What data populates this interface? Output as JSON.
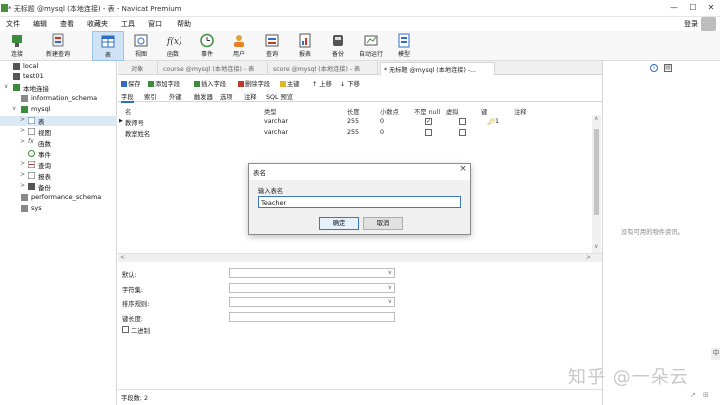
{
  "window": {
    "title": "* 无标题 @mysql (本地连接) - 表 - Navicat Premium",
    "controls": [
      "—",
      "☐",
      "✕"
    ]
  },
  "menu": [
    "文件",
    "编辑",
    "查看",
    "收藏夹",
    "工具",
    "窗口",
    "帮助"
  ],
  "login_label": "登录",
  "toolbar": [
    {
      "label": "连接",
      "icon": "plug-icon"
    },
    {
      "label": "新建查询",
      "icon": "new-query-icon"
    },
    {
      "label": "表",
      "icon": "table-icon",
      "active": true
    },
    {
      "label": "视图",
      "icon": "view-icon"
    },
    {
      "label": "函数",
      "icon": "function-icon"
    },
    {
      "label": "事件",
      "icon": "clock-icon"
    },
    {
      "label": "用户",
      "icon": "user-icon"
    },
    {
      "label": "查询",
      "icon": "query-icon"
    },
    {
      "label": "报表",
      "icon": "report-icon"
    },
    {
      "label": "备份",
      "icon": "backup-icon"
    },
    {
      "label": "自动运行",
      "icon": "autorun-icon"
    },
    {
      "label": "模型",
      "icon": "model-icon"
    }
  ],
  "nav": {
    "items": [
      {
        "label": "local",
        "level": 0,
        "twisty": ""
      },
      {
        "label": "test01",
        "level": 0,
        "twisty": ""
      },
      {
        "label": "本地连接",
        "level": 0,
        "twisty": "∨"
      },
      {
        "label": "information_schema",
        "level": 1,
        "twisty": ""
      },
      {
        "label": "mysql",
        "level": 1,
        "twisty": "∨"
      },
      {
        "label": "表",
        "level": 2,
        "twisty": ">",
        "selected": true
      },
      {
        "label": "视图",
        "level": 2,
        "twisty": ">"
      },
      {
        "label": "函数",
        "level": 2,
        "twisty": ">"
      },
      {
        "label": "事件",
        "level": 2,
        "twisty": ""
      },
      {
        "label": "查询",
        "level": 2,
        "twisty": ">"
      },
      {
        "label": "报表",
        "level": 2,
        "twisty": ">"
      },
      {
        "label": "备份",
        "level": 2,
        "twisty": ">"
      },
      {
        "label": "performance_schema",
        "level": 1,
        "twisty": ""
      },
      {
        "label": "sys",
        "level": 1,
        "twisty": ""
      }
    ]
  },
  "tabs": [
    "对象",
    "course @mysql (本地连接) - 表",
    "score @mysql (本地连接) - 表",
    "* 无标题 @mysql (本地连接) -..."
  ],
  "subtoolbar": [
    "保存",
    "添加字段",
    "插入字段",
    "删除字段",
    "主键",
    "↑ 上移",
    "↓ 下移"
  ],
  "subtabs": [
    "字段",
    "索引",
    "外键",
    "触发器",
    "选项",
    "注释",
    "SQL 预览"
  ],
  "grid": {
    "headers": [
      "名",
      "类型",
      "长度",
      "小数点",
      "不是 null",
      "虚拟",
      "键",
      "注释"
    ],
    "rows": [
      {
        "name": "教师号",
        "type": "varchar",
        "length": "255",
        "decimal": "0",
        "notnull": true,
        "virtual": false,
        "key": "1",
        "current": true
      },
      {
        "name": "教室姓名",
        "type": "varchar",
        "length": "255",
        "decimal": "0",
        "notnull": false,
        "virtual": false,
        "key": "",
        "current": false
      }
    ]
  },
  "props": {
    "default_label": "默认:",
    "charset_label": "字符集:",
    "collation_label": "排序规则:",
    "keylen_label": "键长度:",
    "binary_label": "二进制"
  },
  "status": {
    "field_count": "字段数: 2"
  },
  "rpanel": {
    "empty_text": "没有可用的物件资讯。"
  },
  "dialog": {
    "title": "表名",
    "prompt": "输入表名",
    "value": "Teacher",
    "ok": "确定",
    "cancel": "取消"
  },
  "watermark": "知乎 @一朵云",
  "ime_indicator": "中"
}
